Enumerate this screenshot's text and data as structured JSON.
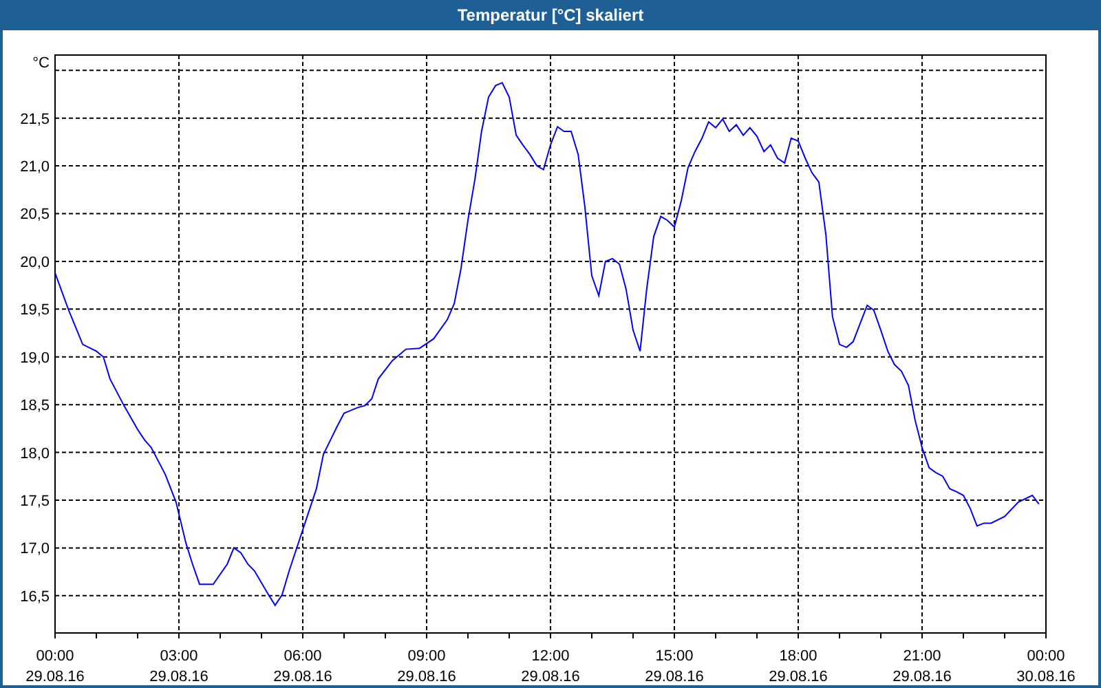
{
  "window": {
    "title": "Temperatur [°C] skaliert"
  },
  "chart": {
    "chart_data": {
      "type": "line",
      "grid": true,
      "ylabel": "°C",
      "xlim": [
        0,
        24
      ],
      "ylim": [
        16.11,
        22.16
      ],
      "xticks": [
        {
          "value": 0,
          "label": "00:00"
        },
        {
          "value": 3,
          "label": "03:00"
        },
        {
          "value": 6,
          "label": "06:00"
        },
        {
          "value": 9,
          "label": "09:00"
        },
        {
          "value": 12,
          "label": "12:00"
        },
        {
          "value": 15,
          "label": "15:00"
        },
        {
          "value": 18,
          "label": "18:00"
        },
        {
          "value": 21,
          "label": "21:00"
        },
        {
          "value": 24,
          "label": "00:00"
        }
      ],
      "yticks": [
        {
          "value": 16.5,
          "label": "16,5"
        },
        {
          "value": 17,
          "label": "17,0"
        },
        {
          "value": 17.5,
          "label": "17,5"
        },
        {
          "value": 18,
          "label": "18,0"
        },
        {
          "value": 18.5,
          "label": "18,5"
        },
        {
          "value": 19,
          "label": "19,0"
        },
        {
          "value": 19.5,
          "label": "19,5"
        },
        {
          "value": 20,
          "label": "20,0"
        },
        {
          "value": 20.5,
          "label": "20,5"
        },
        {
          "value": 21,
          "label": "21,0"
        },
        {
          "value": 21.5,
          "label": "21,5"
        }
      ],
      "x": [
        0,
        0.33,
        0.67,
        1,
        1.17,
        1.33,
        1.67,
        2,
        2.17,
        2.33,
        2.67,
        2.93,
        3.17,
        3.33,
        3.5,
        3.83,
        4.17,
        4.33,
        4.5,
        4.67,
        4.83,
        5.17,
        5.33,
        5.5,
        5.67,
        6,
        6.33,
        6.5,
        6.67,
        6.83,
        7,
        7.33,
        7.5,
        7.67,
        7.83,
        8.17,
        8.5,
        8.83,
        9.17,
        9.5,
        9.67,
        9.83,
        10,
        10.17,
        10.33,
        10.5,
        10.67,
        10.83,
        11,
        11.17,
        11.33,
        11.5,
        11.67,
        11.83,
        12,
        12.17,
        12.33,
        12.5,
        12.67,
        12.83,
        13,
        13.17,
        13.33,
        13.5,
        13.67,
        13.83,
        14,
        14.17,
        14.33,
        14.5,
        14.67,
        14.83,
        15,
        15.17,
        15.33,
        15.5,
        15.67,
        15.83,
        16,
        16.17,
        16.33,
        16.5,
        16.67,
        16.83,
        17,
        17.17,
        17.33,
        17.5,
        17.67,
        17.83,
        18,
        18.17,
        18.33,
        18.5,
        18.67,
        18.83,
        19,
        19.17,
        19.33,
        19.5,
        19.67,
        19.83,
        20,
        20.17,
        20.33,
        20.5,
        20.67,
        20.83,
        21,
        21.17,
        21.33,
        21.5,
        21.67,
        21.83,
        22,
        22.17,
        22.33,
        22.5,
        22.67,
        23,
        23.33,
        23.67,
        23.83
      ],
      "series": [
        {
          "color": "#0000ff",
          "values": [
            19.88,
            19.49,
            19.13,
            19.06,
            19.0,
            18.77,
            18.49,
            18.24,
            18.13,
            18.05,
            17.77,
            17.48,
            17.05,
            16.83,
            16.62,
            16.62,
            16.83,
            17.0,
            16.95,
            16.83,
            16.76,
            16.51,
            16.4,
            16.51,
            16.76,
            17.19,
            17.62,
            17.98,
            18.13,
            18.27,
            18.41,
            18.47,
            18.49,
            18.56,
            18.77,
            18.96,
            19.08,
            19.09,
            19.19,
            19.39,
            19.56,
            19.92,
            20.43,
            20.86,
            21.36,
            21.72,
            21.84,
            21.87,
            21.72,
            21.32,
            21.22,
            21.12,
            21.0,
            20.96,
            21.22,
            21.41,
            21.36,
            21.36,
            21.12,
            20.58,
            19.85,
            19.64,
            20.0,
            20.03,
            19.97,
            19.71,
            19.28,
            19.06,
            19.71,
            20.26,
            20.47,
            20.43,
            20.36,
            20.64,
            20.98,
            21.15,
            21.29,
            21.46,
            21.4,
            21.49,
            21.36,
            21.43,
            21.32,
            21.4,
            21.31,
            21.15,
            21.22,
            21.08,
            21.03,
            21.29,
            21.26,
            21.08,
            20.93,
            20.83,
            20.28,
            19.42,
            19.13,
            19.1,
            19.16,
            19.35,
            19.54,
            19.49,
            19.28,
            19.06,
            18.92,
            18.85,
            18.7,
            18.34,
            18.05,
            17.84,
            17.79,
            17.75,
            17.62,
            17.59,
            17.55,
            17.41,
            17.23,
            17.26,
            17.26,
            17.33,
            17.48,
            17.55,
            17.46
          ]
        }
      ]
    },
    "date_labels": [
      "29.08.16",
      "29.08.16",
      "29.08.16",
      "29.08.16",
      "29.08.16",
      "29.08.16",
      "29.08.16",
      "29.08.16",
      "30.08.16"
    ]
  }
}
